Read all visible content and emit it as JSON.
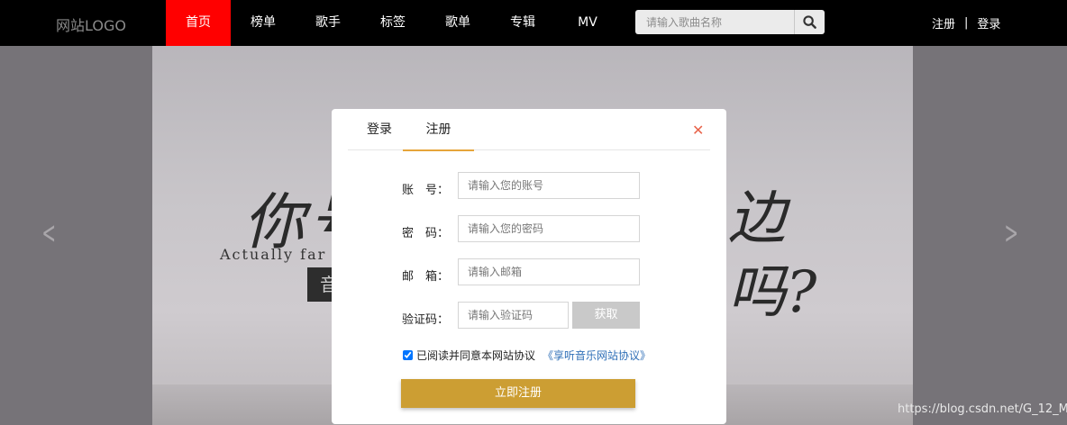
{
  "header": {
    "logo": "网站LOGO",
    "nav": [
      "首页",
      "榜单",
      "歌手",
      "标签",
      "歌单",
      "专辑",
      "MV"
    ],
    "active_index": 0,
    "search_placeholder": "请输入歌曲名称",
    "register": "注册",
    "separator": "|",
    "login": "登录"
  },
  "banner": {
    "calligraphy_left": "你号",
    "calligraphy_right_top": "边",
    "calligraphy_right_bottom": "吗?",
    "english_line": "Actually far si",
    "dark_box_text": "音",
    "watermark": "https://blog.csdn.net/G_12_M"
  },
  "modal": {
    "tab_login": "登录",
    "tab_register": "注册",
    "active_tab": "注册",
    "account_label": "账　号：",
    "account_placeholder": "请输入您的账号",
    "password_label": "密　码：",
    "password_placeholder": "请输入您的密码",
    "email_label": "邮　箱：",
    "email_placeholder": "请输入邮箱",
    "code_label": "验证码：",
    "code_placeholder": "请输入验证码",
    "get_code": "获取",
    "agree_text": "已阅读并同意本网站协议",
    "agree_link": "《享听音乐网站协议》",
    "agree_checked": true,
    "submit": "立即注册"
  },
  "colors": {
    "nav_active": "#ff0000",
    "tab_underline": "#e6a53a",
    "close_icon": "#e8644b",
    "submit_bg": "#cc9e33",
    "link": "#2f6fb7"
  }
}
